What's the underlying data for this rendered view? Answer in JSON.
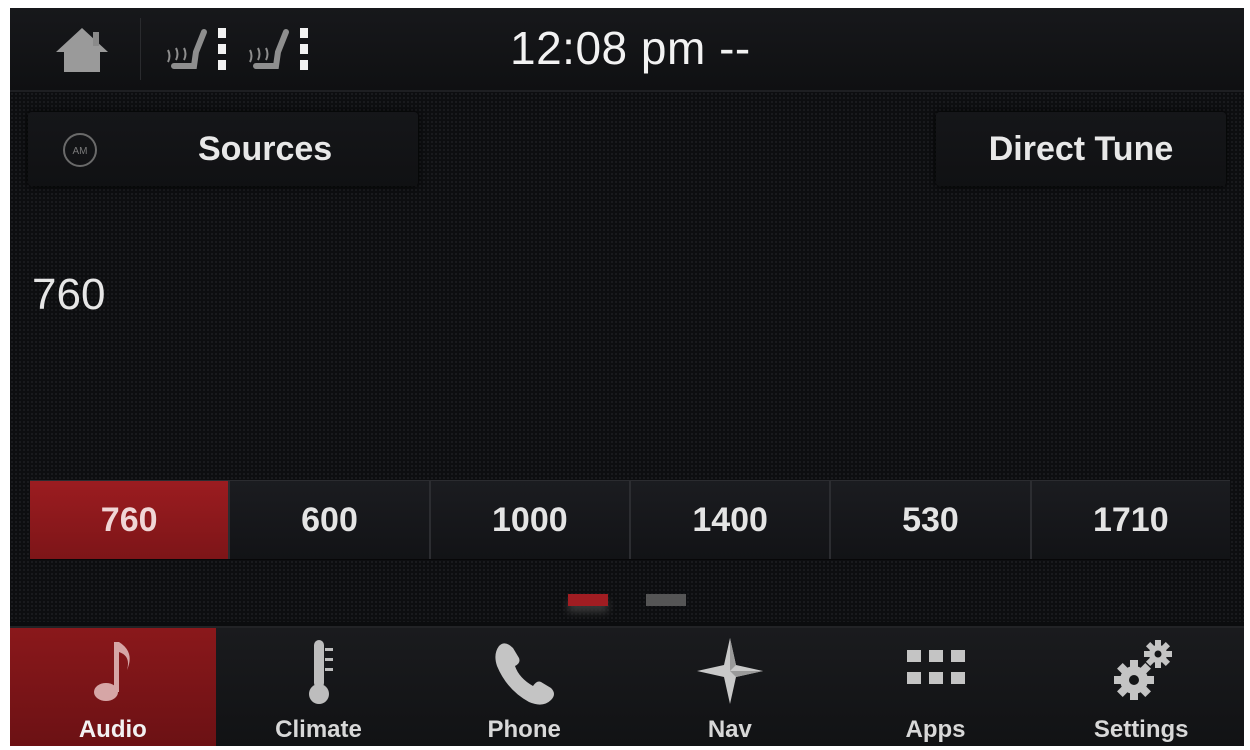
{
  "status_bar": {
    "clock": "12:08 pm --",
    "icons": [
      "home-icon",
      "driver-seat-heat-icon",
      "passenger-seat-heat-icon"
    ]
  },
  "audio": {
    "sources_label": "Sources",
    "sources_icon": "am-radio-icon",
    "direct_tune_label": "Direct Tune",
    "current_frequency": "760"
  },
  "presets": [
    {
      "label": "760",
      "active": true
    },
    {
      "label": "600",
      "active": false
    },
    {
      "label": "1000",
      "active": false
    },
    {
      "label": "1400",
      "active": false
    },
    {
      "label": "530",
      "active": false
    },
    {
      "label": "1710",
      "active": false
    }
  ],
  "preset_pages": {
    "count": 2,
    "current": 1
  },
  "nav": [
    {
      "label": "Audio",
      "icon": "music-note-icon",
      "active": true
    },
    {
      "label": "Climate",
      "icon": "thermometer-icon",
      "active": false
    },
    {
      "label": "Phone",
      "icon": "phone-icon",
      "active": false
    },
    {
      "label": "Nav",
      "icon": "compass-star-icon",
      "active": false
    },
    {
      "label": "Apps",
      "icon": "apps-grid-icon",
      "active": false
    },
    {
      "label": "Settings",
      "icon": "gear-icon",
      "active": false
    }
  ],
  "colors": {
    "accent_red": "#9b1c20",
    "background": "#0b0c0e"
  }
}
